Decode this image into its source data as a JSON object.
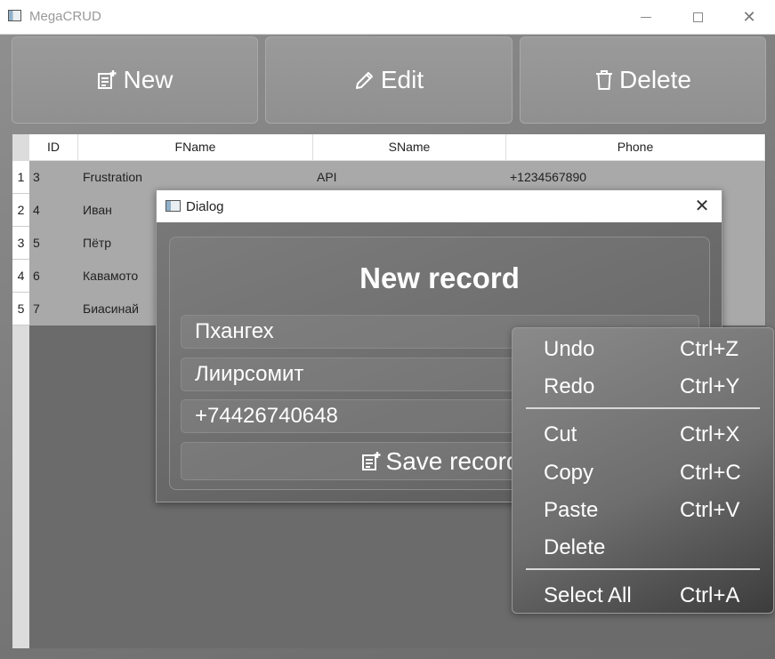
{
  "window": {
    "title": "MegaCRUD",
    "controls": {
      "minimize": "—",
      "maximize": "☐",
      "close": "✕"
    }
  },
  "toolbar": {
    "new_label": "New",
    "edit_label": "Edit",
    "delete_label": "Delete"
  },
  "table": {
    "columns": [
      "ID",
      "FName",
      "SName",
      "Phone"
    ],
    "rows": [
      {
        "num": "1",
        "id": "3",
        "fname": "Frustration",
        "sname": "API",
        "phone": "+1234567890"
      },
      {
        "num": "2",
        "id": "4",
        "fname": "Иван",
        "sname": "",
        "phone": ""
      },
      {
        "num": "3",
        "id": "5",
        "fname": "Пётр",
        "sname": "",
        "phone": ""
      },
      {
        "num": "4",
        "id": "6",
        "fname": "Кавамото",
        "sname": "",
        "phone": ""
      },
      {
        "num": "5",
        "id": "7",
        "fname": "Биасинай",
        "sname": "",
        "phone": ""
      }
    ]
  },
  "dialog": {
    "title": "Dialog",
    "close": "✕",
    "heading": "New record",
    "fields": {
      "fname": "Пхангех",
      "sname": "Лиирсомит",
      "phone": "+74426740648"
    },
    "save_label": "Save record"
  },
  "context_menu": {
    "items": [
      {
        "label": "Undo",
        "shortcut": "Ctrl+Z"
      },
      {
        "label": "Redo",
        "shortcut": "Ctrl+Y"
      },
      {
        "label": "Cut",
        "shortcut": "Ctrl+X"
      },
      {
        "label": "Copy",
        "shortcut": "Ctrl+C"
      },
      {
        "label": "Paste",
        "shortcut": "Ctrl+V"
      },
      {
        "label": "Delete",
        "shortcut": ""
      },
      {
        "label": "Select All",
        "shortcut": "Ctrl+A"
      }
    ]
  },
  "icons": {
    "new": "note-add-icon",
    "edit": "pencil-icon",
    "delete": "trash-icon",
    "save": "note-add-icon"
  }
}
